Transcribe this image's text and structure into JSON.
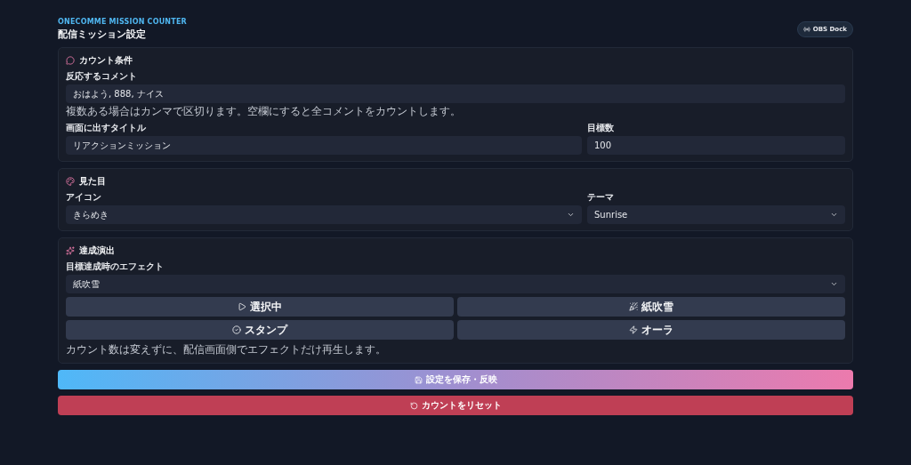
{
  "header": {
    "eyebrow": "ONECOMME MISSION COUNTER",
    "title": "配信ミッション設定",
    "badge": "OBS Dock"
  },
  "sections": [
    {
      "kind": "count",
      "title": "カウント条件",
      "comment_label": "反応するコメント",
      "comment_value": "おはよう, 888, ナイス",
      "hint": "複数ある場合はカンマで区切ります。空欄にすると全コメントをカウントします。",
      "fields": [
        {
          "label": "画面に出すタイトル",
          "value": "リアクションミッション"
        },
        {
          "label": "目標数",
          "value": "100"
        }
      ]
    },
    {
      "kind": "look",
      "title": "見た目",
      "selects": [
        {
          "label": "アイコン",
          "value": "きらめき"
        },
        {
          "label": "テーマ",
          "value": "Sunrise"
        }
      ]
    },
    {
      "kind": "effect",
      "title": "達成演出",
      "select_label": "目標達成時のエフェクト",
      "select_value": "紙吹雪",
      "buttons": [
        {
          "kind": "play",
          "label": "選択中"
        },
        {
          "kind": "confetti",
          "label": "紙吹雪"
        },
        {
          "kind": "check",
          "label": "スタンプ"
        },
        {
          "kind": "zap",
          "label": "オーラ"
        }
      ],
      "note": "カウント数は変えずに、配信画面側でエフェクトだけ再生します。"
    }
  ],
  "actions": [
    {
      "kind": "save",
      "label": "設定を保存・反映"
    },
    {
      "kind": "reset",
      "label": "カウントをリセット"
    }
  ]
}
